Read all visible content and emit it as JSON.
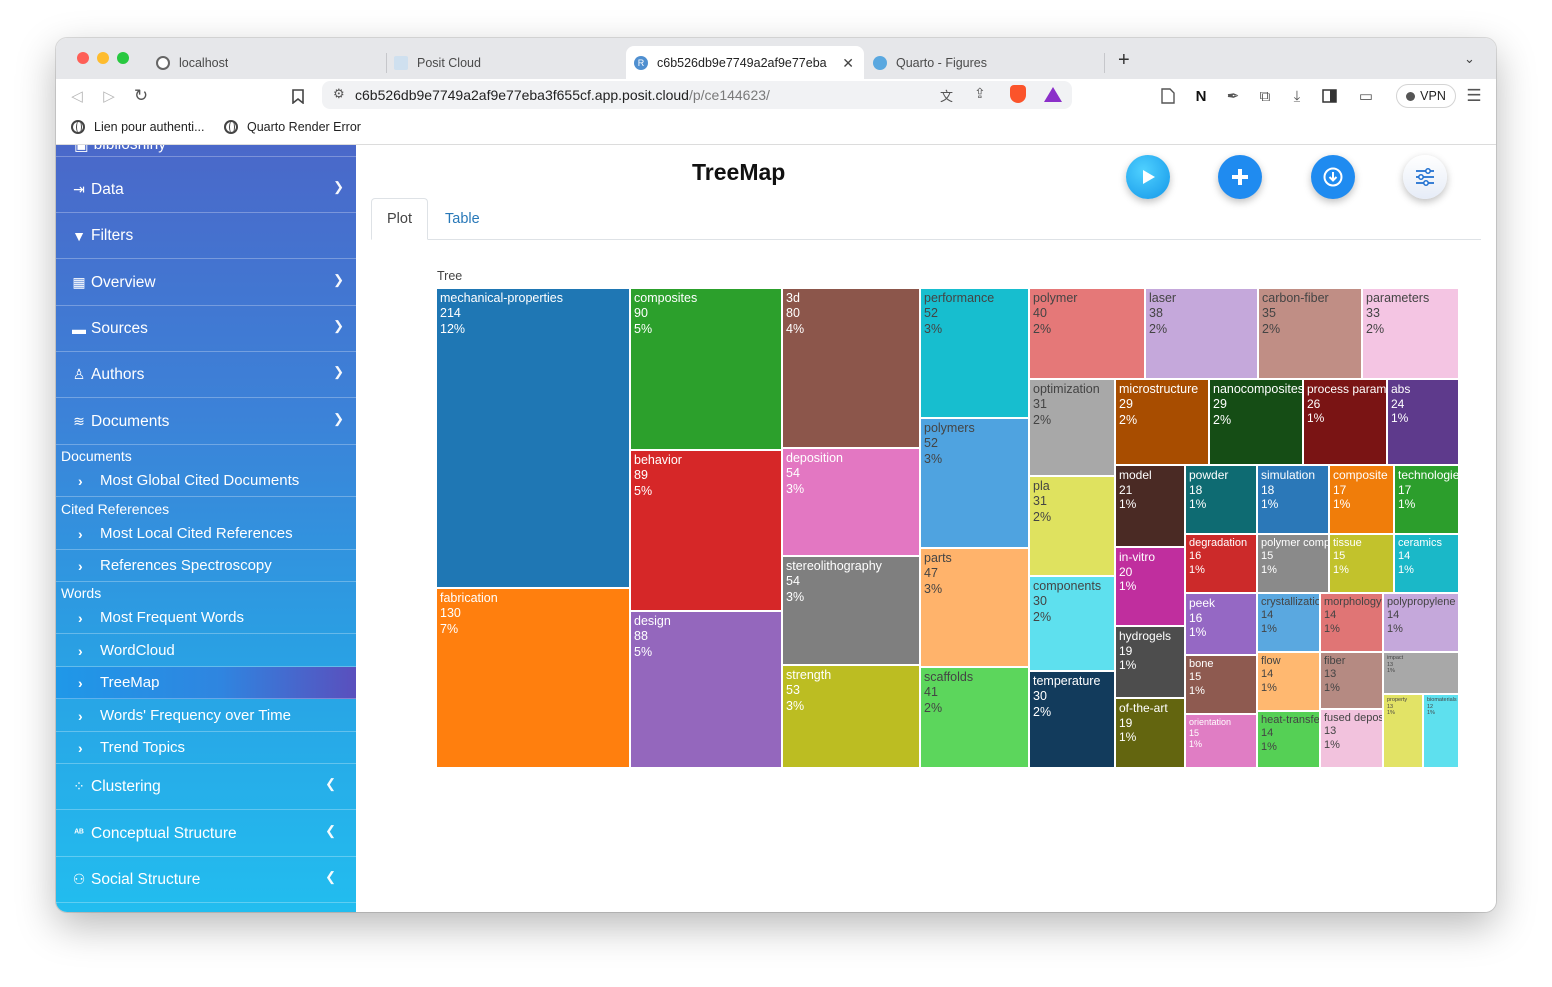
{
  "browser": {
    "tabs": [
      {
        "label": "localhost",
        "icon": "refresh-icon"
      },
      {
        "label": "Posit Cloud",
        "icon": "posit-icon"
      },
      {
        "label": "c6b526db9e7749a2af9e77eba",
        "icon": "r-icon",
        "active": true
      },
      {
        "label": "Quarto - Figures",
        "icon": "globe-icon"
      }
    ],
    "url_main": "c6b526db9e7749a2af9e77eba3f655cf.app.posit.cloud",
    "url_path": "/p/ce144623/",
    "vpn_label": "VPN",
    "bookmarks": [
      "Lien pour authenti...",
      "Quarto Render Error"
    ]
  },
  "sidebar": {
    "partial_label": "biblioshiny",
    "items": [
      {
        "label": "Data",
        "icon": "import-icon",
        "chevron": "v"
      },
      {
        "label": "Filters",
        "icon": "filter-icon",
        "chevron": ""
      },
      {
        "label": "Overview",
        "icon": "table-icon",
        "chevron": "v"
      },
      {
        "label": "Sources",
        "icon": "book-icon",
        "chevron": "v"
      },
      {
        "label": "Authors",
        "icon": "user-icon",
        "chevron": "v"
      },
      {
        "label": "Documents",
        "icon": "layers-icon",
        "chevron": "v"
      }
    ],
    "documents_section": "Documents",
    "documents_items": [
      "Most Global Cited Documents"
    ],
    "cited_section": "Cited References",
    "cited_items": [
      "Most Local Cited References",
      "References Spectroscopy"
    ],
    "words_section": "Words",
    "words_items": [
      "Most Frequent Words",
      "WordCloud",
      "TreeMap",
      "Words' Frequency over Time",
      "Trend Topics"
    ],
    "bottom_items": [
      {
        "label": "Clustering",
        "icon": "spinner-icon"
      },
      {
        "label": "Conceptual Structure",
        "icon": "abc-icon"
      },
      {
        "label": "Social Structure",
        "icon": "users-icon"
      }
    ]
  },
  "main": {
    "title": "TreeMap",
    "tabs": [
      "Plot",
      "Table"
    ]
  },
  "chart_data": {
    "type": "treemap",
    "title": "Tree",
    "items": [
      {
        "label": "mechanical-properties",
        "value": 214,
        "pct": "12%",
        "color": "#1f77b4"
      },
      {
        "label": "fabrication",
        "value": 130,
        "pct": "7%",
        "color": "#ff7f0e"
      },
      {
        "label": "composites",
        "value": 90,
        "pct": "5%",
        "color": "#2ca02c"
      },
      {
        "label": "behavior",
        "value": 89,
        "pct": "5%",
        "color": "#d62728"
      },
      {
        "label": "design",
        "value": 88,
        "pct": "5%",
        "color": "#9467bd"
      },
      {
        "label": "3d",
        "value": 80,
        "pct": "4%",
        "color": "#8c564b"
      },
      {
        "label": "deposition",
        "value": 54,
        "pct": "3%",
        "color": "#e377c2"
      },
      {
        "label": "stereolithography",
        "value": 54,
        "pct": "3%",
        "color": "#7f7f7f"
      },
      {
        "label": "strength",
        "value": 53,
        "pct": "3%",
        "color": "#bcbd22"
      },
      {
        "label": "performance",
        "value": 52,
        "pct": "3%",
        "color": "#17becf"
      },
      {
        "label": "polymers",
        "value": 52,
        "pct": "3%",
        "color": "#4fa3e0"
      },
      {
        "label": "parts",
        "value": 47,
        "pct": "3%",
        "color": "#ffb36b"
      },
      {
        "label": "scaffolds",
        "value": 41,
        "pct": "2%",
        "color": "#5cd65c"
      },
      {
        "label": "polymer",
        "value": 40,
        "pct": "2%",
        "color": "#e57878"
      },
      {
        "label": "laser",
        "value": 38,
        "pct": "2%",
        "color": "#c5a8db"
      },
      {
        "label": "carbon-fiber",
        "value": 35,
        "pct": "2%",
        "color": "#c08e85"
      },
      {
        "label": "parameters",
        "value": 33,
        "pct": "2%",
        "color": "#f4c5e3"
      },
      {
        "label": "optimization",
        "value": 31,
        "pct": "2%",
        "color": "#a8a8a8"
      },
      {
        "label": "pla",
        "value": 31,
        "pct": "2%",
        "color": "#dfe25f"
      },
      {
        "label": "components",
        "value": 30,
        "pct": "2%",
        "color": "#5ee0ee"
      },
      {
        "label": "temperature",
        "value": 30,
        "pct": "2%",
        "color": "#123b5c"
      },
      {
        "label": "microstructure",
        "value": 29,
        "pct": "2%",
        "color": "#a84d00"
      },
      {
        "label": "nanocomposites",
        "value": 29,
        "pct": "2%",
        "color": "#154d15"
      },
      {
        "label": "process parameters",
        "value": 26,
        "pct": "1%",
        "color": "#7a1414"
      },
      {
        "label": "abs",
        "value": 24,
        "pct": "1%",
        "color": "#5e3a8c"
      },
      {
        "label": "model",
        "value": 21,
        "pct": "1%",
        "color": "#4a2a24"
      },
      {
        "label": "in-vitro",
        "value": 20,
        "pct": "1%",
        "color": "#c02e9e"
      },
      {
        "label": "hydrogels",
        "value": 19,
        "pct": "1%",
        "color": "#4d4d4d"
      },
      {
        "label": "of-the-art",
        "value": 19,
        "pct": "1%",
        "color": "#63650f"
      },
      {
        "label": "powder",
        "value": 18,
        "pct": "1%",
        "color": "#0e6b72"
      },
      {
        "label": "simulation",
        "value": 18,
        "pct": "1%",
        "color": "#2b78b8"
      },
      {
        "label": "composite",
        "value": 17,
        "pct": "1%",
        "color": "#f07d0a"
      },
      {
        "label": "technologies",
        "value": 17,
        "pct": "1%",
        "color": "#2c9e2c"
      },
      {
        "label": "degradation",
        "value": 16,
        "pct": "1%",
        "color": "#cc2a2a"
      },
      {
        "label": "polymer composites",
        "value": 15,
        "pct": "1%",
        "color": "#8a8a8a"
      },
      {
        "label": "tissue",
        "value": 15,
        "pct": "1%",
        "color": "#c2c22c"
      },
      {
        "label": "ceramics",
        "value": 14,
        "pct": "1%",
        "color": "#1ab8c8"
      },
      {
        "label": "peek",
        "value": 16,
        "pct": "1%",
        "color": "#9568c4"
      },
      {
        "label": "bone",
        "value": 15,
        "pct": "1%",
        "color": "#8e5a50"
      },
      {
        "label": "orientation",
        "value": 15,
        "pct": "1%",
        "color": "#e07dc4"
      },
      {
        "label": "crystallization",
        "value": 14,
        "pct": "1%",
        "color": "#5aa8e0"
      },
      {
        "label": "morphology",
        "value": 14,
        "pct": "1%",
        "color": "#e07575"
      },
      {
        "label": "polypropylene",
        "value": 14,
        "pct": "1%",
        "color": "#c5a8db"
      },
      {
        "label": "flow",
        "value": 14,
        "pct": "1%",
        "color": "#ffb870"
      },
      {
        "label": "heat-transfer",
        "value": 14,
        "pct": "1%",
        "color": "#55d055"
      },
      {
        "label": "fiber",
        "value": 13,
        "pct": "1%",
        "color": "#b58a82"
      },
      {
        "label": "impact",
        "value": 13,
        "pct": "1%",
        "color": "#a8a8a8"
      },
      {
        "label": "fused deposition",
        "value": 13,
        "pct": "1%",
        "color": "#f2c2dd"
      },
      {
        "label": "property",
        "value": 13,
        "pct": "1%",
        "color": "#e2e366"
      },
      {
        "label": "biomaterials",
        "value": 12,
        "pct": "1%",
        "color": "#5ee0ee"
      }
    ]
  }
}
